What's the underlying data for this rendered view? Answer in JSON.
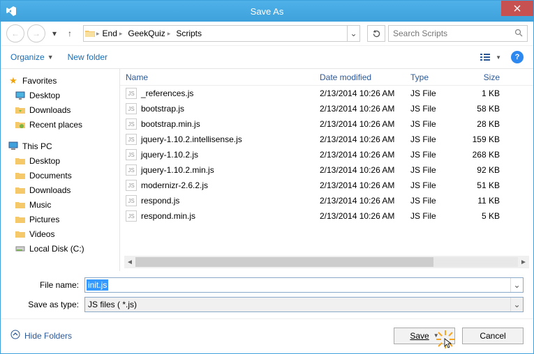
{
  "window": {
    "title": "Save As"
  },
  "breadcrumb": {
    "parts": [
      "End",
      "GeekQuiz",
      "Scripts"
    ]
  },
  "search": {
    "placeholder": "Search Scripts"
  },
  "toolbar": {
    "organize": "Organize",
    "new_folder": "New folder"
  },
  "sidebar": {
    "favorites": "Favorites",
    "fav_items": [
      "Desktop",
      "Downloads",
      "Recent places"
    ],
    "this_pc": "This PC",
    "pc_items": [
      "Desktop",
      "Documents",
      "Downloads",
      "Music",
      "Pictures",
      "Videos",
      "Local Disk (C:)"
    ]
  },
  "columns": {
    "name": "Name",
    "date": "Date modified",
    "type": "Type",
    "size": "Size"
  },
  "files": [
    {
      "name": "_references.js",
      "date": "2/13/2014 10:26 AM",
      "type": "JS File",
      "size": "1 KB"
    },
    {
      "name": "bootstrap.js",
      "date": "2/13/2014 10:26 AM",
      "type": "JS File",
      "size": "58 KB"
    },
    {
      "name": "bootstrap.min.js",
      "date": "2/13/2014 10:26 AM",
      "type": "JS File",
      "size": "28 KB"
    },
    {
      "name": "jquery-1.10.2.intellisense.js",
      "date": "2/13/2014 10:26 AM",
      "type": "JS File",
      "size": "159 KB"
    },
    {
      "name": "jquery-1.10.2.js",
      "date": "2/13/2014 10:26 AM",
      "type": "JS File",
      "size": "268 KB"
    },
    {
      "name": "jquery-1.10.2.min.js",
      "date": "2/13/2014 10:26 AM",
      "type": "JS File",
      "size": "92 KB"
    },
    {
      "name": "modernizr-2.6.2.js",
      "date": "2/13/2014 10:26 AM",
      "type": "JS File",
      "size": "51 KB"
    },
    {
      "name": "respond.js",
      "date": "2/13/2014 10:26 AM",
      "type": "JS File",
      "size": "11 KB"
    },
    {
      "name": "respond.min.js",
      "date": "2/13/2014 10:26 AM",
      "type": "JS File",
      "size": "5 KB"
    }
  ],
  "form": {
    "file_name_label": "File name:",
    "file_name_value": "init.js",
    "save_type_label": "Save as type:",
    "save_type_value": "JS files  ( *.js)"
  },
  "footer": {
    "hide": "Hide Folders",
    "save": "Save",
    "cancel": "Cancel"
  }
}
